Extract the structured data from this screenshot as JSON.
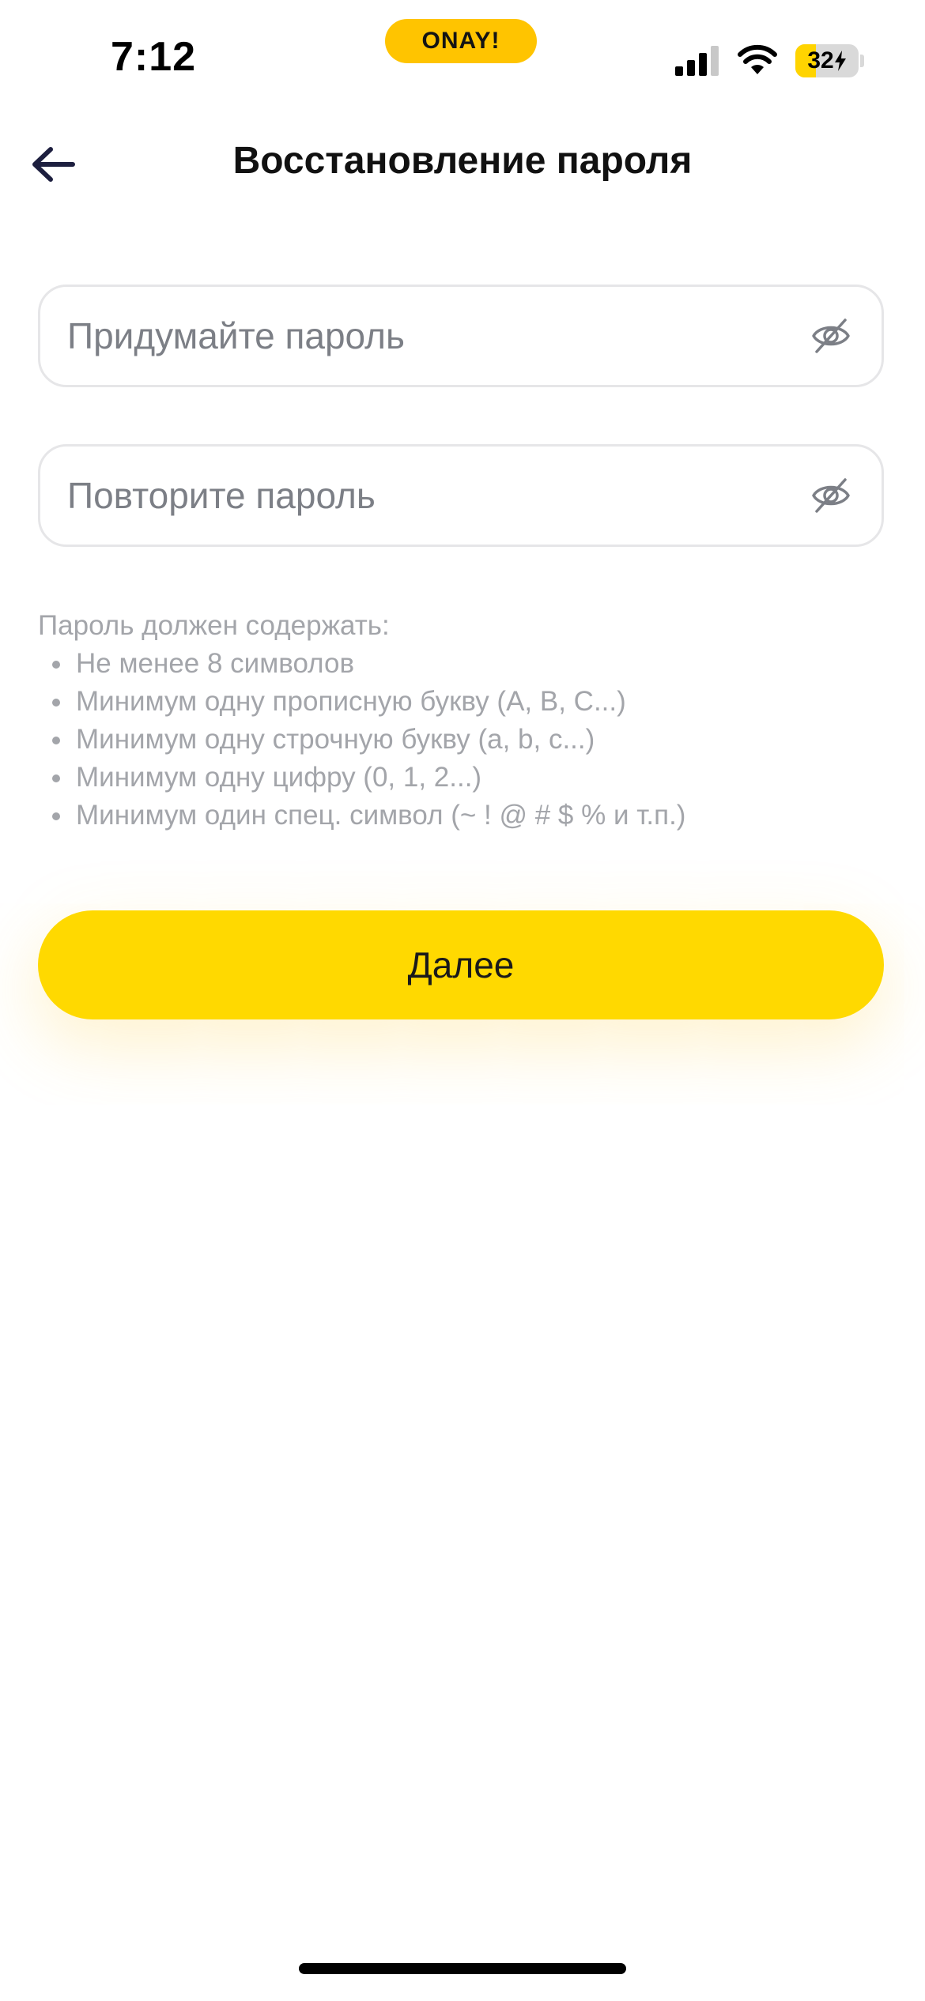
{
  "status_bar": {
    "time": "7:12",
    "app_badge": "ONAY!",
    "battery_level": "32",
    "battery_percent": 32,
    "charging": true,
    "accent_color": "#ffc400"
  },
  "header": {
    "back_icon": "arrow-left-icon",
    "title": "Восстановление пароля"
  },
  "form": {
    "new_password": {
      "placeholder": "Придумайте пароль",
      "value": "",
      "toggle_icon": "eye-off-icon"
    },
    "repeat_password": {
      "placeholder": "Повторите пароль",
      "value": "",
      "toggle_icon": "eye-off-icon"
    }
  },
  "requirements": {
    "title": "Пароль должен содержать:",
    "items": [
      "Не менее 8 символов",
      "Минимум одну прописную букву (A, B, C...)",
      "Минимум одну строчную букву (a, b, c...)",
      "Минимум одну цифру (0, 1, 2...)",
      "Минимум один спец. символ (~ ! @ # $ % и т.п.)"
    ]
  },
  "actions": {
    "next_label": "Далее",
    "button_color": "#ffd900"
  }
}
